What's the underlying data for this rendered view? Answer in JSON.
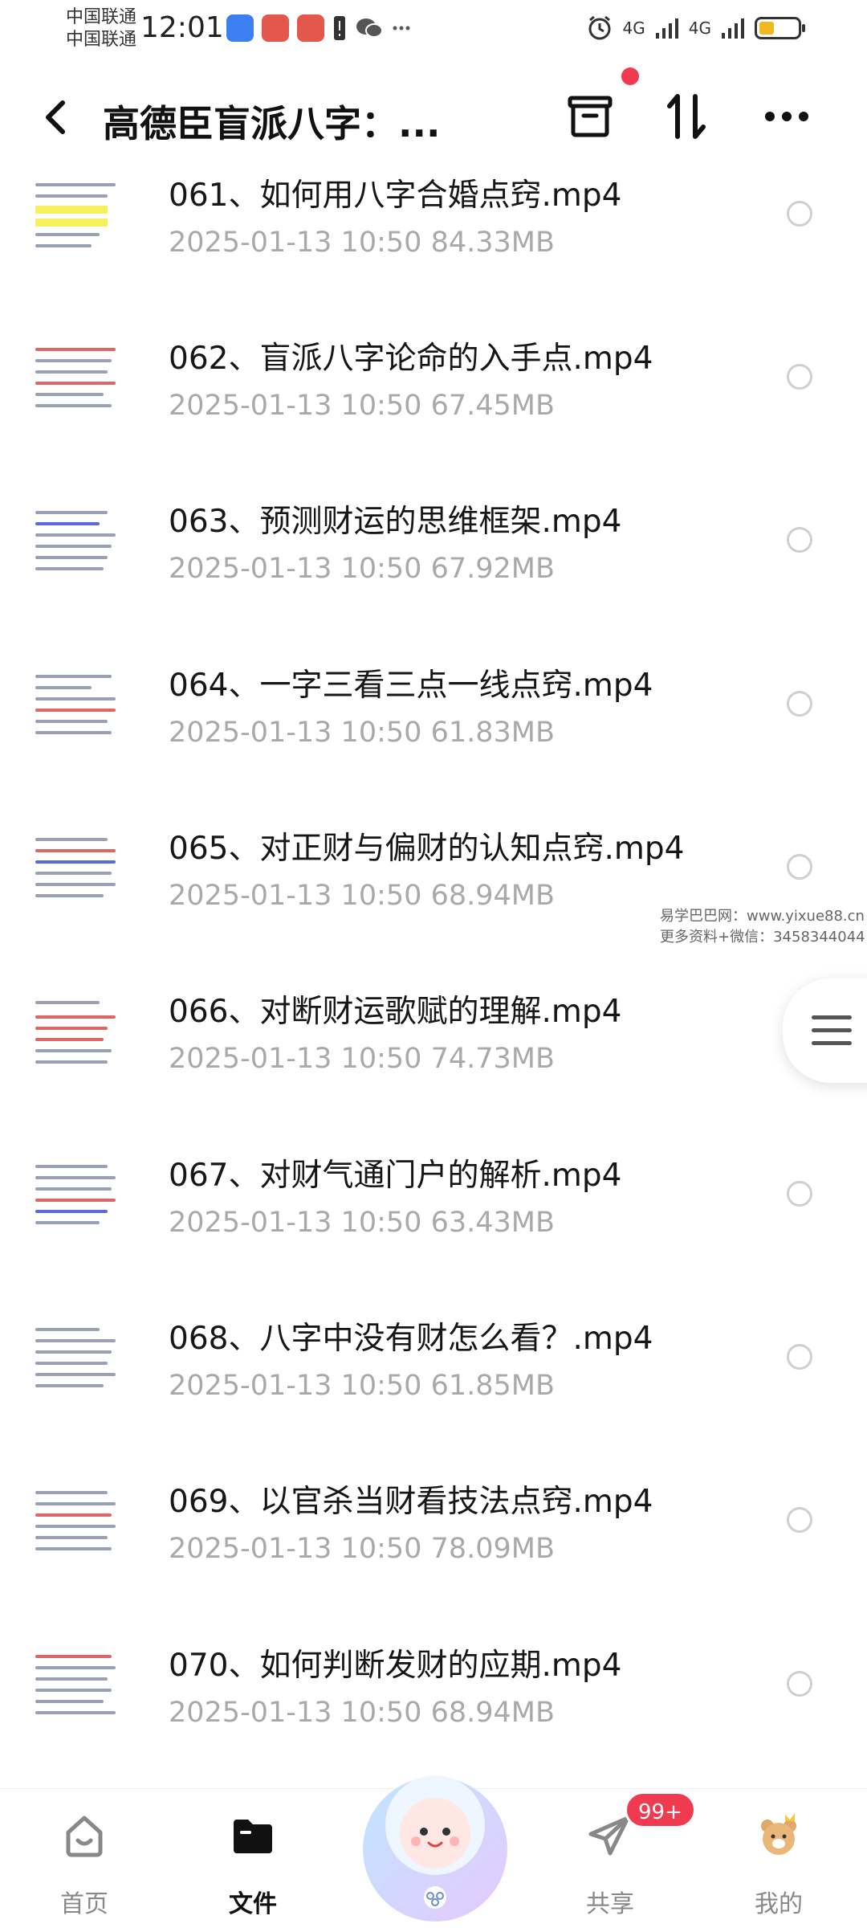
{
  "status_bar": {
    "carrier_1": "中国联通",
    "carrier_2": "中国联通",
    "time": "12:01",
    "network_1": "4G",
    "network_2": "4G",
    "icons": [
      "alarm-icon",
      "signal-icon",
      "battery-icon",
      "wechat-icon",
      "more-icon"
    ]
  },
  "header": {
    "title": "高德臣盲派八字：...",
    "icons": [
      "back-icon",
      "archive-icon",
      "sort-icon",
      "more-icon"
    ]
  },
  "files": [
    {
      "name": "061、如何用八字合婚点窍.mp4",
      "date": "2025-01-13",
      "time": "10:50",
      "size": "84.33MB"
    },
    {
      "name": "062、盲派八字论命的入手点.mp4",
      "date": "2025-01-13",
      "time": "10:50",
      "size": "67.45MB"
    },
    {
      "name": "063、预测财运的思维框架.mp4",
      "date": "2025-01-13",
      "time": "10:50",
      "size": "67.92MB"
    },
    {
      "name": "064、一字三看三点一线点窍.mp4",
      "date": "2025-01-13",
      "time": "10:50",
      "size": "61.83MB"
    },
    {
      "name": "065、对正财与偏财的认知点窍.mp4",
      "date": "2025-01-13",
      "time": "10:50",
      "size": "68.94MB"
    },
    {
      "name": "066、对断财运歌赋的理解.mp4",
      "date": "2025-01-13",
      "time": "10:50",
      "size": "74.73MB"
    },
    {
      "name": "067、对财气通门户的解析.mp4",
      "date": "2025-01-13",
      "time": "10:50",
      "size": "63.43MB"
    },
    {
      "name": "068、八字中没有财怎么看？.mp4",
      "date": "2025-01-13",
      "time": "10:50",
      "size": "61.85MB"
    },
    {
      "name": "069、以官杀当财看技法点窍.mp4",
      "date": "2025-01-13",
      "time": "10:50",
      "size": "78.09MB"
    },
    {
      "name": "070、如何判断发财的应期.mp4",
      "date": "2025-01-13",
      "time": "10:50",
      "size": "68.94MB"
    }
  ],
  "watermark": {
    "line1": "易学巴巴网：www.yixue88.cn",
    "line2": "更多资料+微信：3458344044"
  },
  "bottom_nav": {
    "home": "首页",
    "files": "文件",
    "share": "共享",
    "mine": "我的",
    "share_badge": "99+"
  },
  "colors": {
    "accent": "#f03a4f",
    "meta_gray": "#a9a9a9",
    "title_black": "#111111"
  }
}
